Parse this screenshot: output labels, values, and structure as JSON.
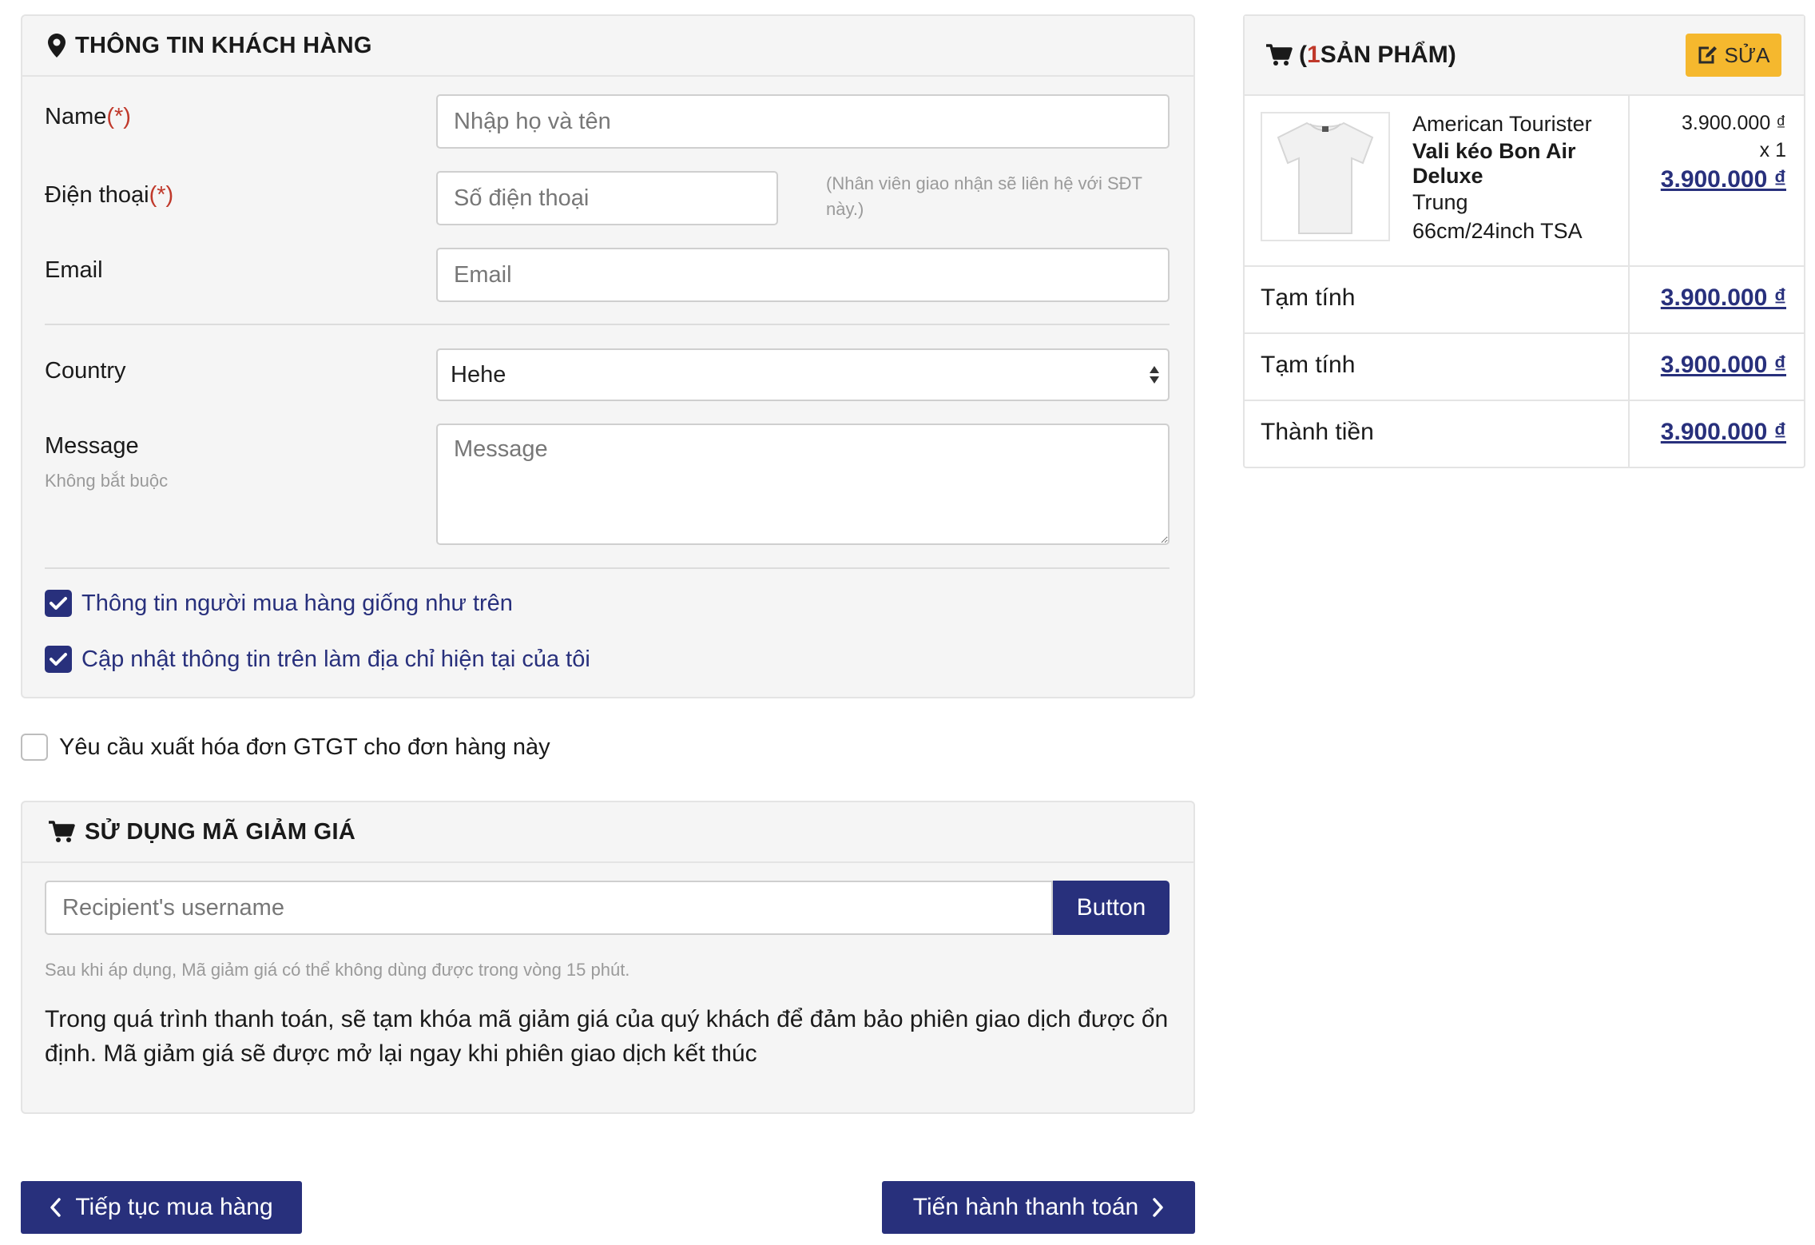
{
  "customer": {
    "header_title": "THÔNG TIN KHÁCH HÀNG",
    "required_mark": "(*)",
    "name_label": "Name",
    "name_placeholder": "Nhập họ và tên",
    "phone_label": "Điện thoại",
    "phone_placeholder": "Số điện thoại",
    "phone_hint": "(Nhân viên giao nhận sẽ liên hệ với SĐT này.)",
    "email_label": "Email",
    "email_placeholder": "Email",
    "country_label": "Country",
    "country_value": "Hehe",
    "message_label": "Message",
    "message_optional": "Không bắt buộc",
    "message_placeholder": "Message",
    "check_same_buyer": "Thông tin người mua hàng giống như trên",
    "check_update_address": "Cập nhật thông tin trên làm địa chỉ hiện tại của tôi"
  },
  "invoice_request_label": "Yêu cầu xuất hóa đơn GTGT cho đơn hàng này",
  "coupon": {
    "header_title": "SỬ DỤNG MÃ GIẢM GIÁ",
    "input_placeholder": "Recipient's username",
    "button_label": "Button",
    "note_small": "Sau khi áp dụng, Mã giảm giá có thể không dùng được trong vòng 15 phút.",
    "note_main": "Trong quá trình thanh toán, sẽ tạm khóa mã giảm giá của quý khách để đảm bảo phiên giao dịch được ổn định. Mã giảm giá sẽ được mở lại ngay khi phiên giao dịch kết thúc"
  },
  "nav": {
    "continue_label": "Tiếp tục mua hàng",
    "checkout_label": "Tiến hành thanh toán"
  },
  "order": {
    "count_prefix": "(",
    "count": "1",
    "count_suffix": " SẢN PHẨM)",
    "edit_label": "SỬA",
    "item": {
      "brand": "American Tourister",
      "name": "Vali kéo Bon Air Deluxe",
      "size_line1": "Trung",
      "size_line2": "66cm/24inch TSA",
      "unit_price": "3.900.000 ₫",
      "qty": "x 1",
      "line_total": "3.900.000 ₫"
    },
    "rows": [
      {
        "label": "Tạm tính",
        "value": "3.900.000 ₫"
      },
      {
        "label": "Tạm tính",
        "value": "3.900.000 ₫"
      },
      {
        "label": "Thành tiền",
        "value": "3.900.000 ₫"
      }
    ]
  },
  "colors": {
    "primary": "#28307c",
    "warning": "#f5b82e",
    "required": "#c0392b"
  }
}
